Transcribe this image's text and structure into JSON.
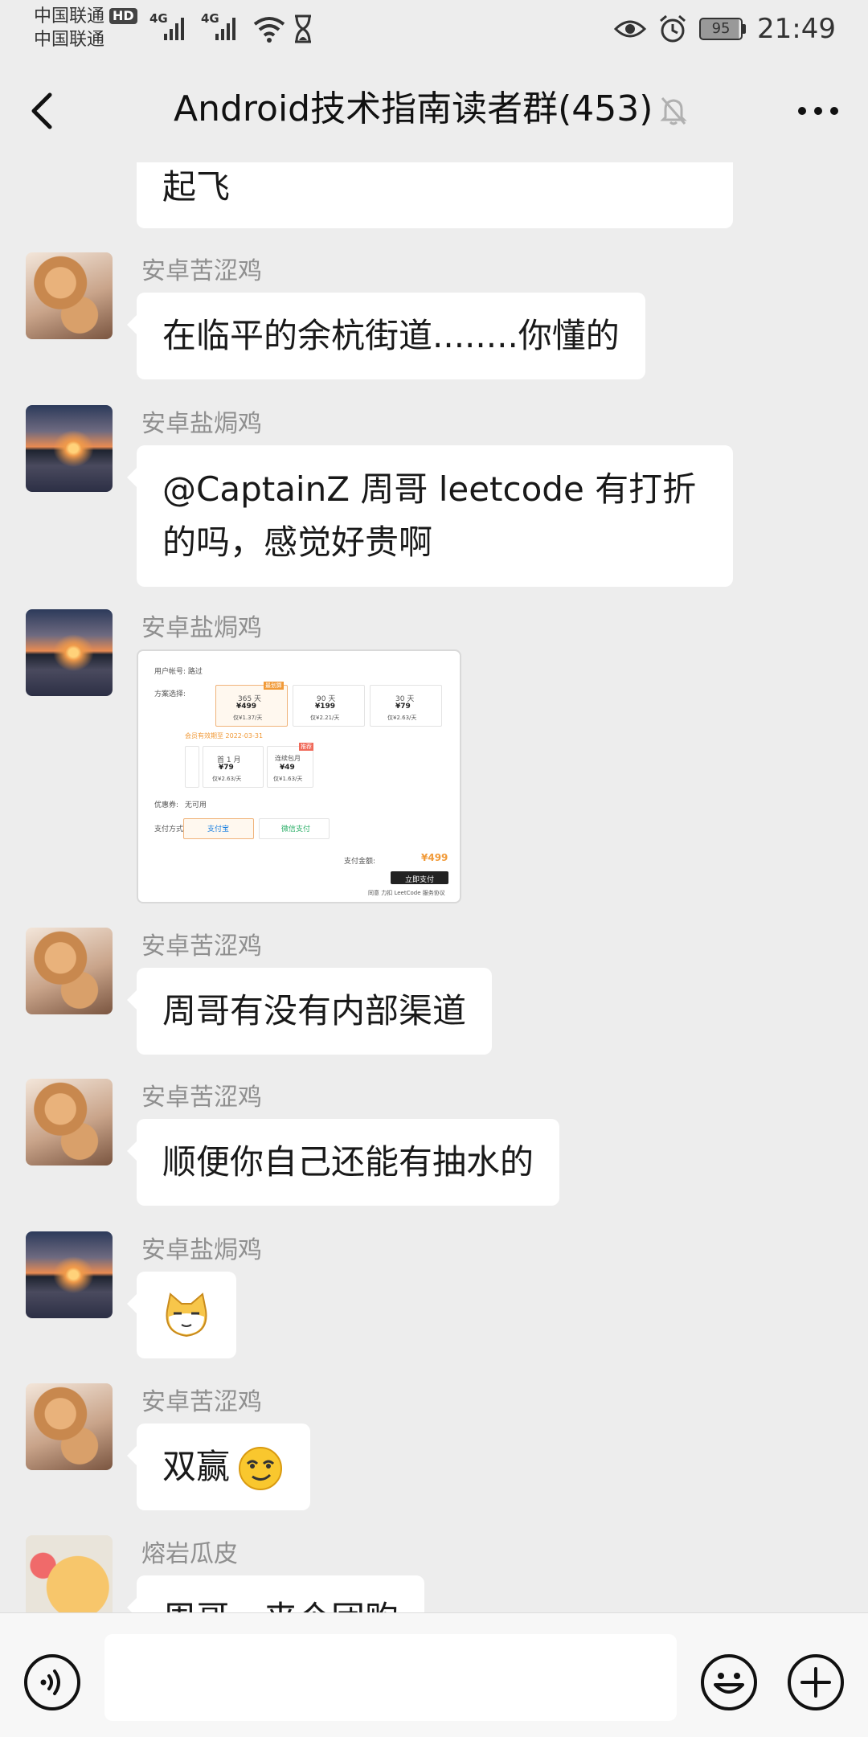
{
  "status_bar": {
    "carrier_1": "中国联通",
    "hd_badge": "HD",
    "carrier_2": "中国联通",
    "signal_1": "4G",
    "signal_2": "4G",
    "battery": "95",
    "time": "21:49"
  },
  "header": {
    "title": "Android技术指南读者群(453)",
    "icons": {
      "back": "back-chevron-icon",
      "mute": "bell-muted-icon",
      "more": "more-dots-icon"
    }
  },
  "messages": [
    {
      "type": "text",
      "text": "起飞"
    },
    {
      "sender": "安卓苦涩鸡",
      "type": "text",
      "text": "在临平的余杭街道........你懂的"
    },
    {
      "sender": "安卓盐焗鸡",
      "type": "text",
      "line1": "@CaptainZ  周哥 leetcode 有打折",
      "line2": "的吗，感觉好贵啊"
    },
    {
      "sender": "安卓盐焗鸡",
      "type": "image",
      "image": {
        "account_label": "用户帐号:",
        "account_value": "路过",
        "plan_label": "方案选择:",
        "plans": [
          {
            "term": "365 天",
            "price": "¥499",
            "per": "仅¥1.37/天",
            "badge": "最划算"
          },
          {
            "term": "90 天",
            "price": "¥199",
            "per": "仅¥2.21/天"
          },
          {
            "term": "30 天",
            "price": "¥79",
            "per": "仅¥2.63/天"
          }
        ],
        "expire_note": "会员有效期至 2022-03-31",
        "sub_plans": [
          {
            "term": "首 1 月",
            "price": "¥79",
            "per": "仅¥2.63/天"
          },
          {
            "term": "连续包月",
            "price": "¥49",
            "per": "仅¥1.63/天",
            "badge": "推荐"
          }
        ],
        "coupon_label": "优惠券:",
        "coupon_value": "无可用",
        "pay_label": "支付方式:",
        "pay_alipay": "支付宝",
        "pay_wechat": "微信支付",
        "total_label": "支付金额:",
        "total": "¥499",
        "pay_button": "立即支付",
        "agree": "同意 力扣 LeetCode 服务协议"
      }
    },
    {
      "sender": "安卓苦涩鸡",
      "type": "text",
      "text": "周哥有没有内部渠道"
    },
    {
      "sender": "安卓苦涩鸡",
      "type": "text",
      "text": "顺便你自己还能有抽水的"
    },
    {
      "sender": "安卓盐焗鸡",
      "type": "emoji",
      "icon": "cat-face-emoji-icon"
    },
    {
      "sender": "安卓苦涩鸡",
      "type": "text",
      "text": "双赢",
      "icon": "smirk-emoji-icon"
    },
    {
      "sender": "熔岩瓜皮",
      "type": "text",
      "text": "周哥，来个团购"
    }
  ],
  "input_bar": {
    "placeholder": "",
    "icons": {
      "voice": "voice-icon",
      "emoji": "emoji-icon",
      "plus": "plus-icon"
    }
  },
  "colors": {
    "background": "#ededed",
    "bubble": "#ffffff",
    "sender_name": "#8f8f8f",
    "accent_orange": "#f19a38"
  }
}
